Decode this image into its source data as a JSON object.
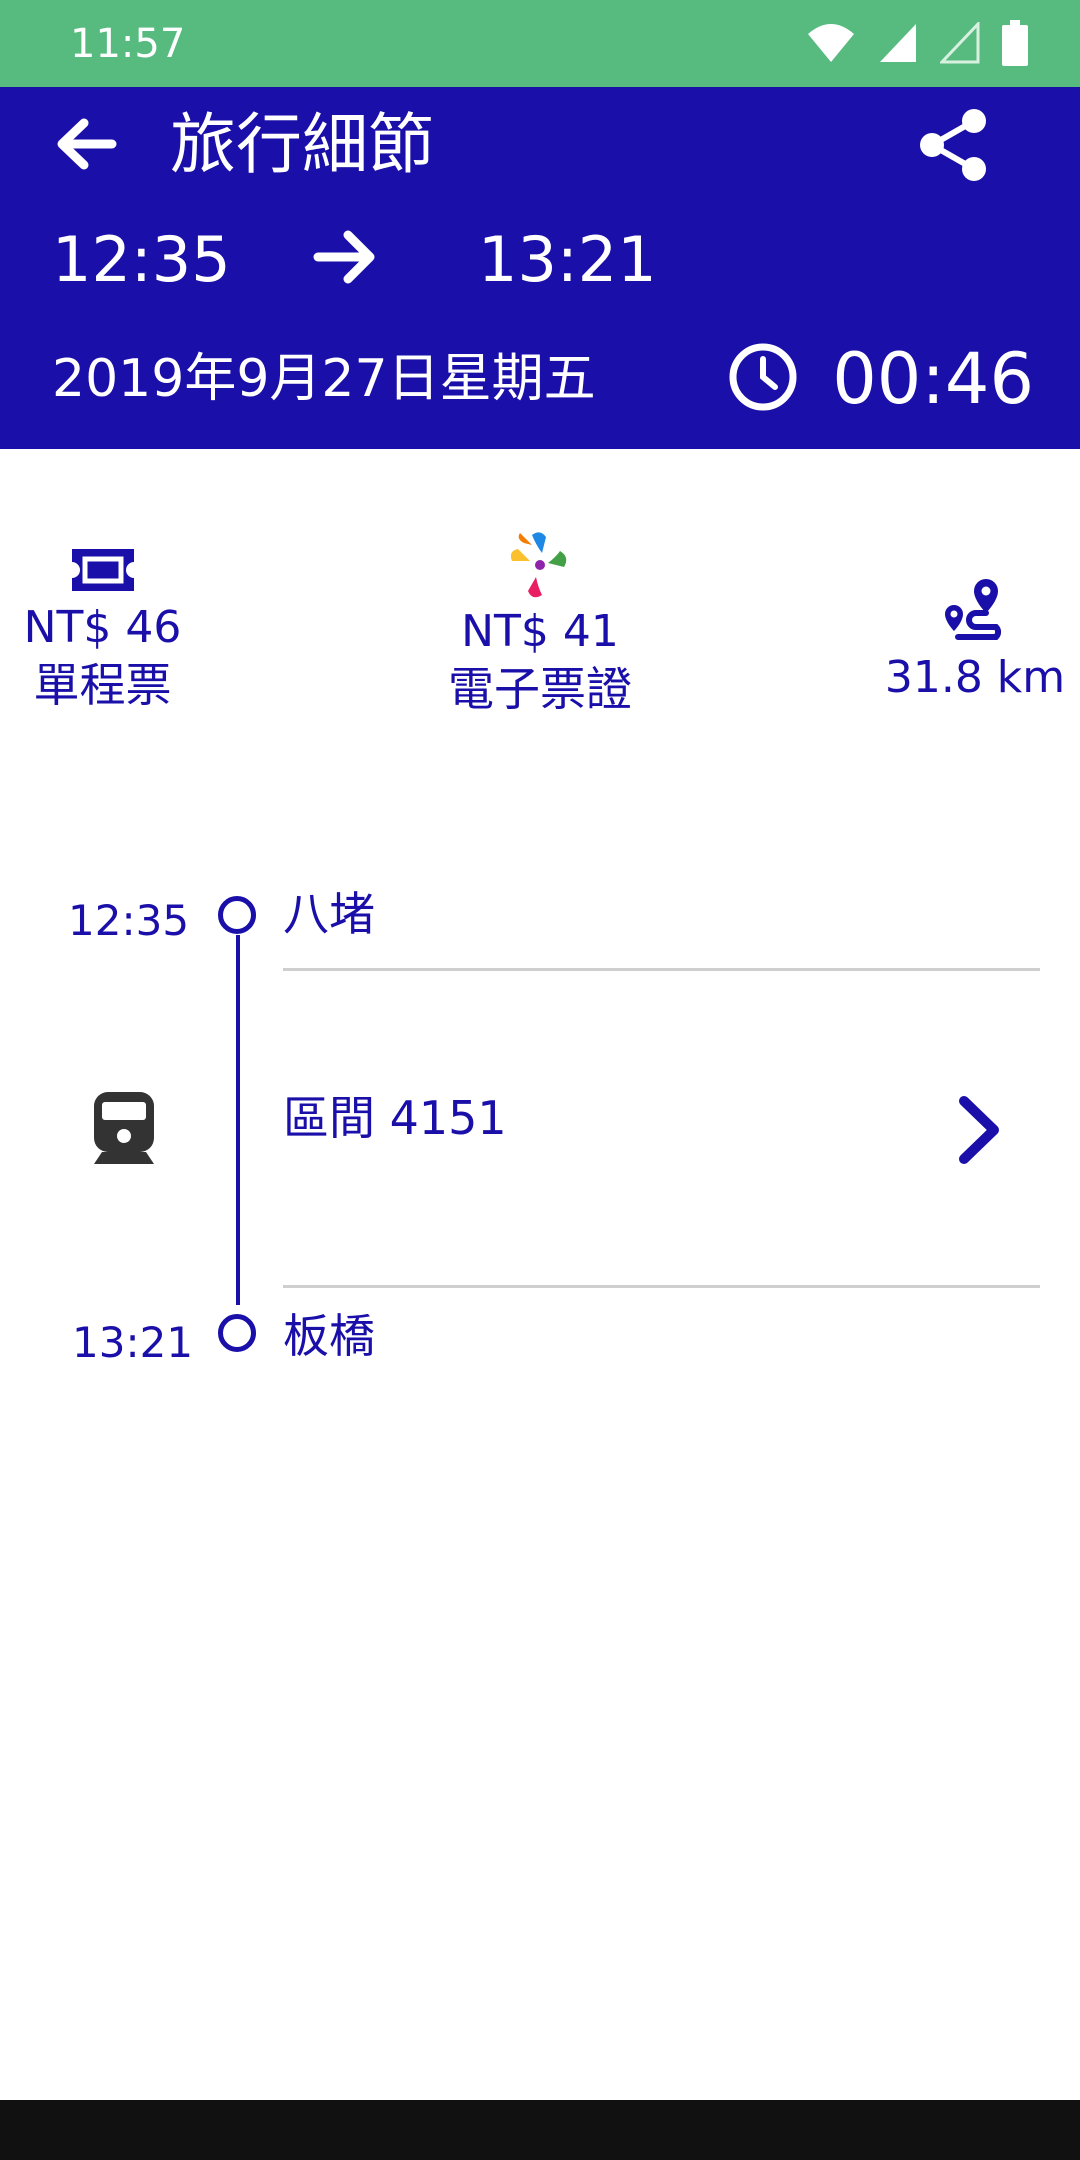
{
  "status_bar": {
    "time": "11:57"
  },
  "header": {
    "title": "旅行細節",
    "departure_time": "12:35",
    "arrival_time": "13:21",
    "date": "2019年9月27日星期五",
    "duration": "00:46"
  },
  "fares": {
    "single_ticket": {
      "price": "NT$ 46",
      "label": "單程票"
    },
    "e_ticket": {
      "price": "NT$ 41",
      "label": "電子票證"
    },
    "distance": "31.8 km"
  },
  "timeline": {
    "origin": {
      "time": "12:35",
      "station": "八堵"
    },
    "train": {
      "label": "區間 4151"
    },
    "destination": {
      "time": "13:21",
      "station": "板橋"
    }
  },
  "colors": {
    "primary": "#1a0fa8",
    "status_bar": "#57bb80",
    "divider": "#cfcfcf"
  },
  "icons": [
    "back-arrow-icon",
    "share-icon",
    "arrow-right-icon",
    "clock-icon",
    "ticket-icon",
    "e-ticket-logo-icon",
    "route-icon",
    "train-icon",
    "chevron-right-icon"
  ]
}
